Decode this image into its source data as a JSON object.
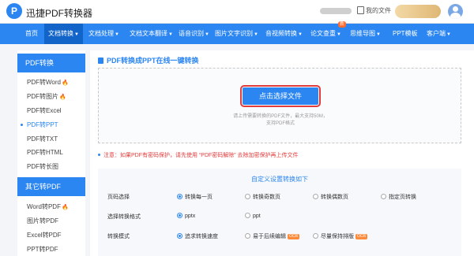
{
  "app": {
    "title": "迅捷PDF转换器",
    "logo_char": "P",
    "my_files_label": "我的文件"
  },
  "nav": {
    "items": [
      {
        "label": "首页",
        "caret": ""
      },
      {
        "label": "文档转换",
        "caret": "▼"
      },
      {
        "label": "文档处理",
        "caret": "▼"
      },
      {
        "label": "文档文本翻译",
        "caret": "▼"
      },
      {
        "label": "语音识别",
        "caret": "▼"
      },
      {
        "label": "图片文字识别",
        "caret": "▼"
      },
      {
        "label": "音视频转换",
        "caret": "▼"
      },
      {
        "label": "论文查重",
        "caret": "▼"
      },
      {
        "label": "思维导图",
        "caret": "▼"
      },
      {
        "label": "PPT模板",
        "caret": ""
      },
      {
        "label": "客户端",
        "caret": "▼"
      }
    ],
    "badge": "新",
    "active_index": 1
  },
  "sidebar": {
    "group1_title": "PDF转换",
    "group1_items": [
      {
        "label": "PDF转Word",
        "hot": "🔥"
      },
      {
        "label": "PDF转图片",
        "hot": "🔥"
      },
      {
        "label": "PDF转Excel",
        "hot": ""
      },
      {
        "label": "PDF转PPT",
        "hot": ""
      },
      {
        "label": "PDF转TXT",
        "hot": ""
      },
      {
        "label": "PDF转HTML",
        "hot": ""
      },
      {
        "label": "PDF转长图",
        "hot": ""
      }
    ],
    "active_item": "PDF转PPT",
    "group2_title": "其它转PDF",
    "group2_items": [
      {
        "label": "Word转PDF",
        "hot": "🔥"
      },
      {
        "label": "图片转PDF",
        "hot": ""
      },
      {
        "label": "Excel转PDF",
        "hot": ""
      },
      {
        "label": "PPT转PDF",
        "hot": ""
      }
    ]
  },
  "main": {
    "title": "PDF转换成PPT在线一键转换",
    "upload_button": "点击选择文件",
    "hint_line1": "请上传需要转换的PDF文件，最大支持50M，",
    "hint_line2": "支持PDF格式",
    "notice": "注意：如果PDF有密码保护，请先使用 “PDF密码解除” 去除加密保护再上传文件",
    "settings_title": "自定义设置转换如下",
    "rows": [
      {
        "label": "页码选择",
        "options": [
          {
            "label": "转换每一页",
            "selected": true,
            "tag": ""
          },
          {
            "label": "转换奇数页",
            "selected": false,
            "tag": ""
          },
          {
            "label": "转换偶数页",
            "selected": false,
            "tag": ""
          },
          {
            "label": "指定页转换",
            "selected": false,
            "tag": ""
          }
        ]
      },
      {
        "label": "选择转换格式",
        "options": [
          {
            "label": "pptx",
            "selected": true,
            "tag": ""
          },
          {
            "label": "ppt",
            "selected": false,
            "tag": ""
          }
        ]
      },
      {
        "label": "转换模式",
        "options": [
          {
            "label": "追求转换速度",
            "selected": true,
            "tag": ""
          },
          {
            "label": "易于后续编辑",
            "selected": false,
            "tag": "OCR"
          },
          {
            "label": "尽量保持排版",
            "selected": false,
            "tag": "OCR"
          }
        ]
      }
    ]
  },
  "colors": {
    "brand": "#2b86f2",
    "nav_active": "#1264c9",
    "warning": "#e23b3b",
    "hot": "#ff6a2a"
  }
}
